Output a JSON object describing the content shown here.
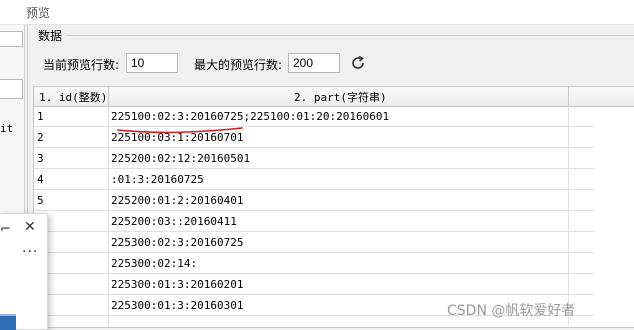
{
  "window": {
    "title": "预览"
  },
  "left_panel": {
    "item_text": "it"
  },
  "popup": {
    "pin_icon": "pin-icon",
    "close_label": "✕",
    "more_label": "···"
  },
  "group": {
    "label": "数据"
  },
  "preview_rows": {
    "label": "当前预览行数:",
    "value": "10"
  },
  "max_preview_rows": {
    "label": "最大的预览行数:",
    "value": "200"
  },
  "refresh_icon": "refresh-icon",
  "table": {
    "headers": [
      "1. id(整数)",
      "2. part(字符串)"
    ],
    "rows": [
      [
        "1",
        "225100:02:3:20160725;225100:01:20:20160601"
      ],
      [
        "2",
        "225100:03:1:20160701"
      ],
      [
        "3",
        "225200:02:12:20160501"
      ],
      [
        "4",
        ":01:3:20160725"
      ],
      [
        "5",
        "225200:01:2:20160401"
      ],
      [
        "6",
        "225200:03::20160411"
      ],
      [
        "",
        "225300:02:3:20160725"
      ],
      [
        "",
        "225300:02:14:"
      ],
      [
        "",
        "225300:01:3:20160201"
      ],
      [
        "",
        "225300:01:3:20160301"
      ]
    ]
  },
  "annotation": {
    "color": "#d11f1f"
  },
  "watermark": "CSDN @帆软爱好者"
}
